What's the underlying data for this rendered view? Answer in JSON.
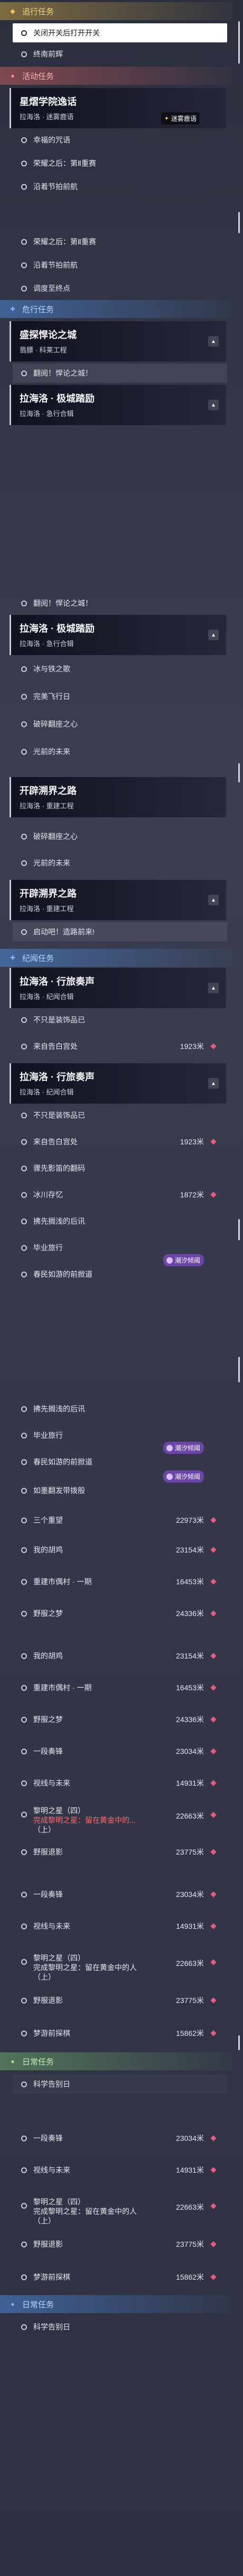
{
  "sections": {
    "yellow1": {
      "title": "追行任务",
      "icon": "shield-icon"
    },
    "red1": {
      "title": "活动任务",
      "icon": "pin-icon"
    },
    "blue1": {
      "title": "危行任务",
      "icon": "plus-icon"
    },
    "blue2": {
      "title": "纪闻任务",
      "icon": "plus-icon"
    },
    "green1": {
      "title": "日常任务",
      "icon": "pin-icon"
    },
    "blue3": {
      "title": "日常任务",
      "icon": "pin-icon"
    }
  },
  "cards": {
    "c1": {
      "title": "星熠学院逸话",
      "subtitle": "拉海洛 · 迷雾鹿语",
      "tag": "迷雾鹿语"
    },
    "c2": {
      "title": "盛探悍论之城",
      "subtitle": "翡膘 · 科莱工程"
    },
    "c3": {
      "title": "拉海洛 · 极城踏励",
      "subtitle": "拉海洛 · 急行合辑"
    },
    "c4": {
      "title": "拉海洛 · 极城踏励",
      "subtitle": "拉海洛 · 急行合辑"
    },
    "c5": {
      "title": "开辟溯界之路",
      "subtitle": "拉海洛 · 重建工程"
    },
    "c6": {
      "title": "开辟溯界之路",
      "subtitle": "拉海洛 · 重建工程"
    },
    "c7": {
      "title": "拉海洛 · 行旅奏声",
      "subtitle": "拉海洛 · 纪闻合辑"
    },
    "c8": {
      "title": "拉海洛 · 行旅奏声",
      "subtitle": "拉海洛 · 纪闻合辑"
    }
  },
  "rows": {
    "r1": {
      "label": "关闭开关后打开开关"
    },
    "r2": {
      "label": "终南前辉"
    },
    "r3": {
      "label": "幸福的咒语"
    },
    "r4": {
      "label": "荣耀之后：第Ⅱ重赛"
    },
    "r5": {
      "label": "沿着节拍前航"
    },
    "r6": {
      "label": "荣耀之后：第Ⅱ重赛"
    },
    "r7": {
      "label": "沿着节拍前航"
    },
    "r8": {
      "label": "调度至终点"
    },
    "r9": {
      "label": "翻阅！悍论之城！"
    },
    "r10": {
      "label": "翻阅！悍论之城！"
    },
    "r11": {
      "label": "冰与铁之歌"
    },
    "r12": {
      "label": "完美飞行日"
    },
    "r13": {
      "label": "破碎翻座之心"
    },
    "r14": {
      "label": "光前的未来"
    },
    "r15": {
      "label": "破碎翻座之心"
    },
    "r16": {
      "label": "光前的未来"
    },
    "r17": {
      "label": "启动吧！造路前来!"
    },
    "r18": {
      "label": "不只是装饰品已"
    },
    "r19": {
      "label": "来自告白宫处",
      "distance": "1923米"
    },
    "r20": {
      "label": "不只是装饰品已"
    },
    "r21": {
      "label": "来自告白宫处",
      "distance": "1923米"
    },
    "r22": {
      "label": "骤先影笛的翻码"
    },
    "r23": {
      "label": "冰川存忆",
      "distance": "1872米"
    },
    "r24": {
      "label": "拂先搁浅的后讯"
    },
    "r25": {
      "label": "毕业旅行"
    },
    "r26": {
      "label": "春民如游的前掀道",
      "badge": "潮汐倾阈"
    },
    "r27": {
      "label": "拂先搁浅的后讯"
    },
    "r28": {
      "label": "毕业旅行"
    },
    "r29": {
      "label": "春民如游的前掀道",
      "badge": "潮汐倾阈"
    },
    "r30": {
      "label": "如墨翻发带拨般",
      "badge": "潮汐倾阈"
    },
    "r31": {
      "label": "三个重望",
      "distance": "22973米"
    },
    "r32": {
      "label": "我的胡鸡",
      "distance": "23154米"
    },
    "r33": {
      "label": "重建市偶村 · 一期",
      "distance": "16453米"
    },
    "r34": {
      "label": "野服之梦",
      "distance": "24336米"
    },
    "r35": {
      "label": "我的胡鸡",
      "distance": "23154米"
    },
    "r36": {
      "label": "重建市偶村 · 一期",
      "distance": "16453米"
    },
    "r37": {
      "label": "野服之梦",
      "distance": "24336米"
    },
    "r38": {
      "label": "一段奏锋",
      "distance": "23034米"
    },
    "r39": {
      "label": "视线与未来",
      "distance": "14931米"
    },
    "r40": {
      "line1": "黎明之星（四）",
      "line2": "完成黎明之星：留在黄金中的...",
      "line3": "（上）",
      "distance": "22663米"
    },
    "r41": {
      "label": "野服退影",
      "distance": "23775米"
    },
    "r42": {
      "label": "一段奏锋",
      "distance": "23034米"
    },
    "r43": {
      "label": "视线与未来",
      "distance": "14931米"
    },
    "r44": {
      "line1": "黎明之星（四）",
      "line2": "完成黎明之星：留在黄金中的人",
      "line3": "（上）",
      "distance": "22663米"
    },
    "r45": {
      "label": "野服退影",
      "distance": "23775米"
    },
    "r46": {
      "label": "梦游前探棋",
      "distance": "15862米"
    },
    "r47": {
      "label": "科学告别日"
    },
    "r48": {
      "label": "一段奏锋",
      "distance": "23034米"
    },
    "r49": {
      "label": "视线与未来",
      "distance": "14931米"
    },
    "r50": {
      "line1": "黎明之星（四）",
      "line2": "完成黎明之星：留在黄金中的人",
      "line3": "（上）",
      "distance": "22663米"
    },
    "r51": {
      "label": "野服退影",
      "distance": "23775米"
    },
    "r52": {
      "label": "梦游前探棋",
      "distance": "15862米"
    },
    "r53": {
      "label": "科学告别日"
    }
  }
}
